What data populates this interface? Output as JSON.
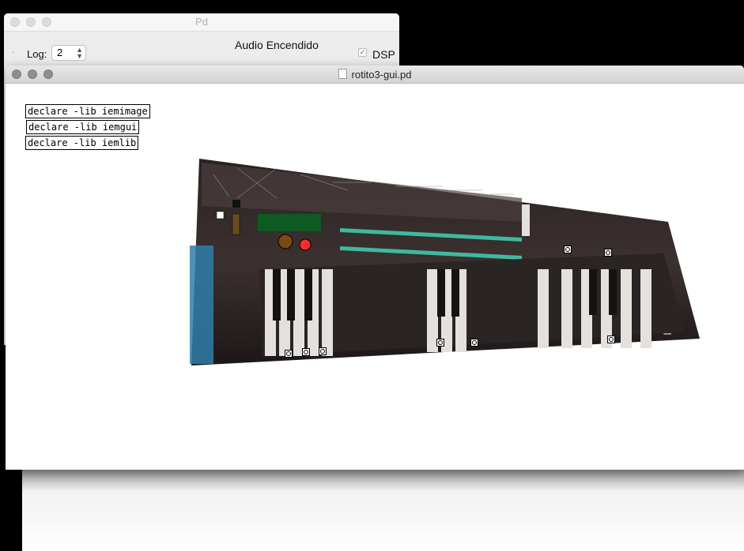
{
  "pd_window": {
    "title": "Pd",
    "log_label": "Log:",
    "log_value": "2",
    "audio_status": "Audio Encendido",
    "dsp_label": "DSP",
    "dsp_checked": true
  },
  "patch_window": {
    "title": "rotito3-gui.pd",
    "objects": [
      {
        "text": "declare -lib iemimage"
      },
      {
        "text": "declare -lib iemgui"
      },
      {
        "text": "declare -lib iemlib"
      }
    ],
    "image_brand": "AKAI"
  },
  "colors": {
    "display_green": "#0d5a23",
    "red_button": "#ff2a2a",
    "brown_button": "#7a4a12",
    "teal_buttons": "#3fb9a0"
  }
}
